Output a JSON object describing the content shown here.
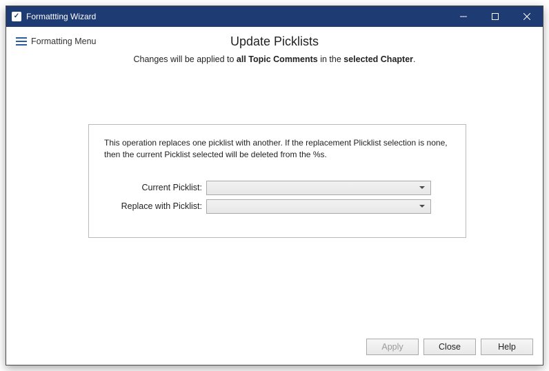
{
  "window": {
    "title": "Formattting Wizard"
  },
  "menu": {
    "label": "Formatting Menu"
  },
  "page": {
    "title": "Update Picklists",
    "sub_prefix": "Changes will be applied to ",
    "sub_bold1": "all Topic Comments",
    "sub_mid": " in the ",
    "sub_bold2": "selected Chapter",
    "sub_suffix": "."
  },
  "panel": {
    "description": "This operation replaces one picklist with another.  If the replacement Plicklist selection is none, then the current Picklist selected will be deleted from the %s.",
    "current_label": "Current Picklist:",
    "replace_label": "Replace with Picklist:",
    "current_value": "",
    "replace_value": ""
  },
  "buttons": {
    "apply": "Apply",
    "close": "Close",
    "help": "Help"
  }
}
